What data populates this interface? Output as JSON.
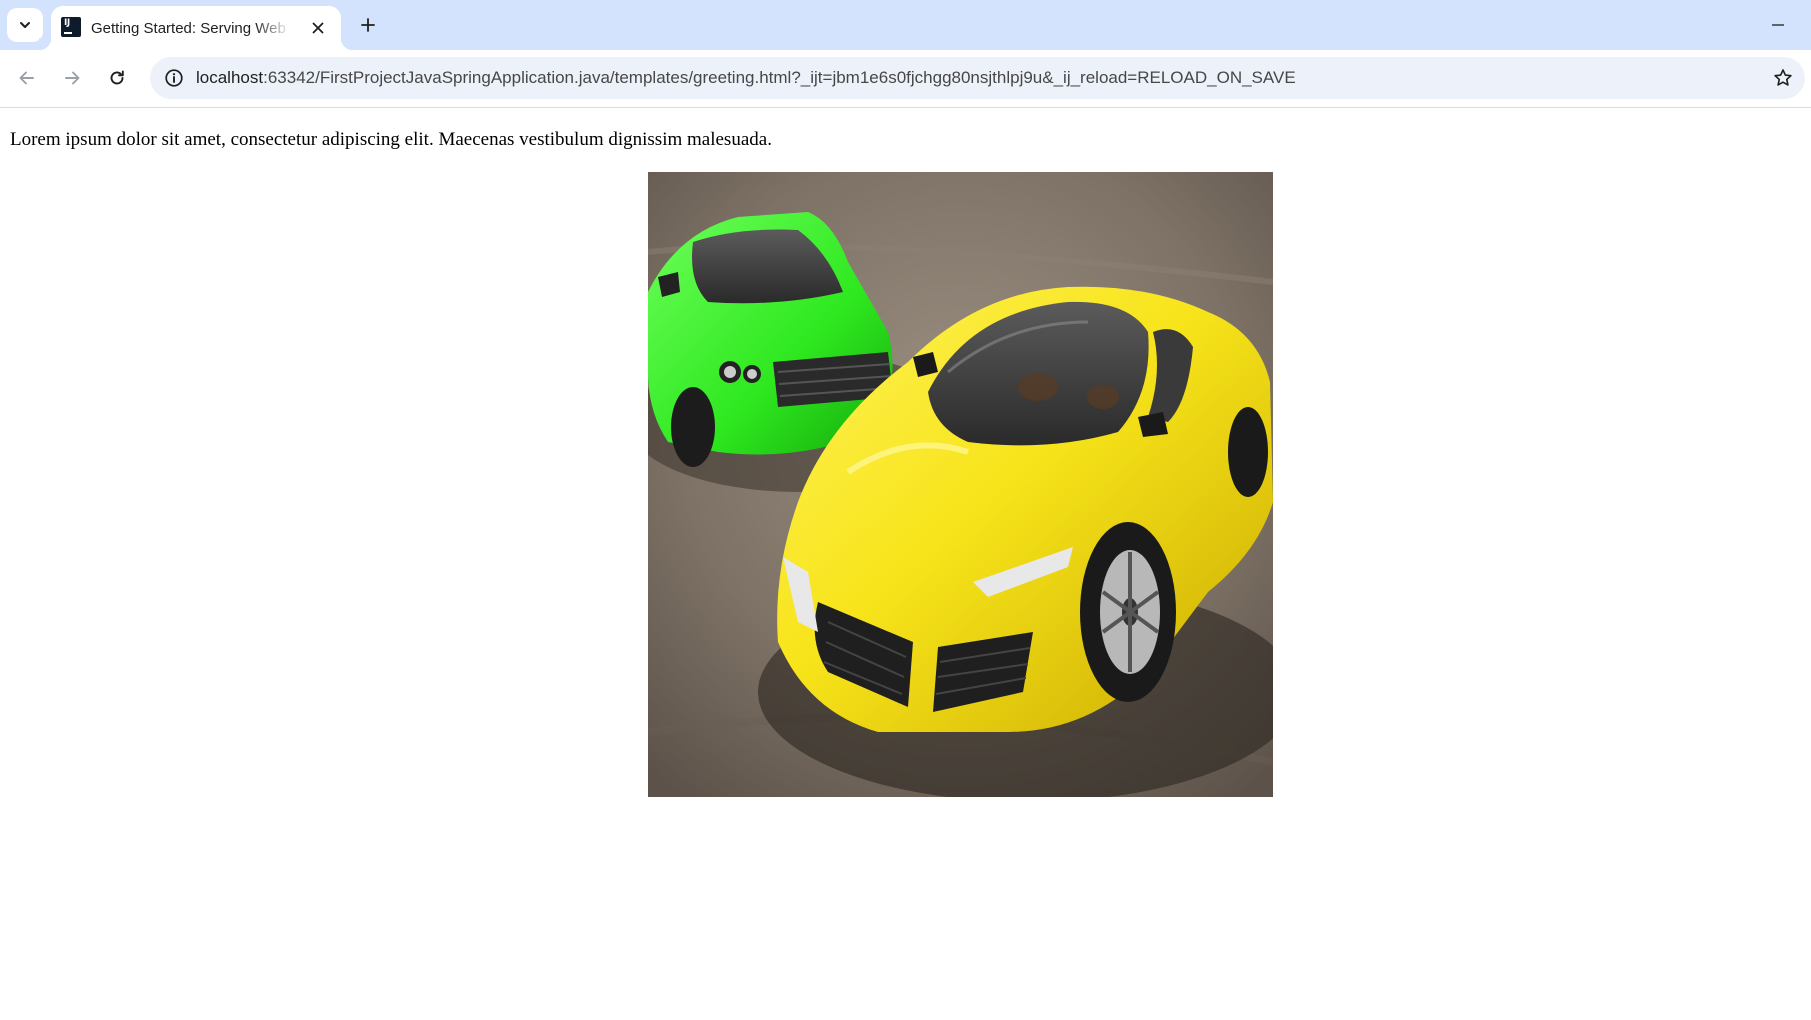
{
  "browser": {
    "tab": {
      "title": "Getting Started: Serving Web Content",
      "favicon": "intellij-icon"
    },
    "address_bar": {
      "url_host": "localhost",
      "url_rest": ":63342/FirstProjectJavaSpringApplication.java/templates/greeting.html?_ijt=jbm1e6s0fjchgg80nsjthlpj9u&_ij_reload=RELOAD_ON_SAVE"
    },
    "colors": {
      "tabstrip": "#d3e3fd",
      "omnibox": "#edf2fa"
    }
  },
  "page": {
    "paragraph": "Lorem ipsum dolor sit amet, consectetur adipiscing elit. Maecenas vestibulum dignissim malesuada.",
    "image": {
      "description_icon": "cars-photo"
    }
  }
}
